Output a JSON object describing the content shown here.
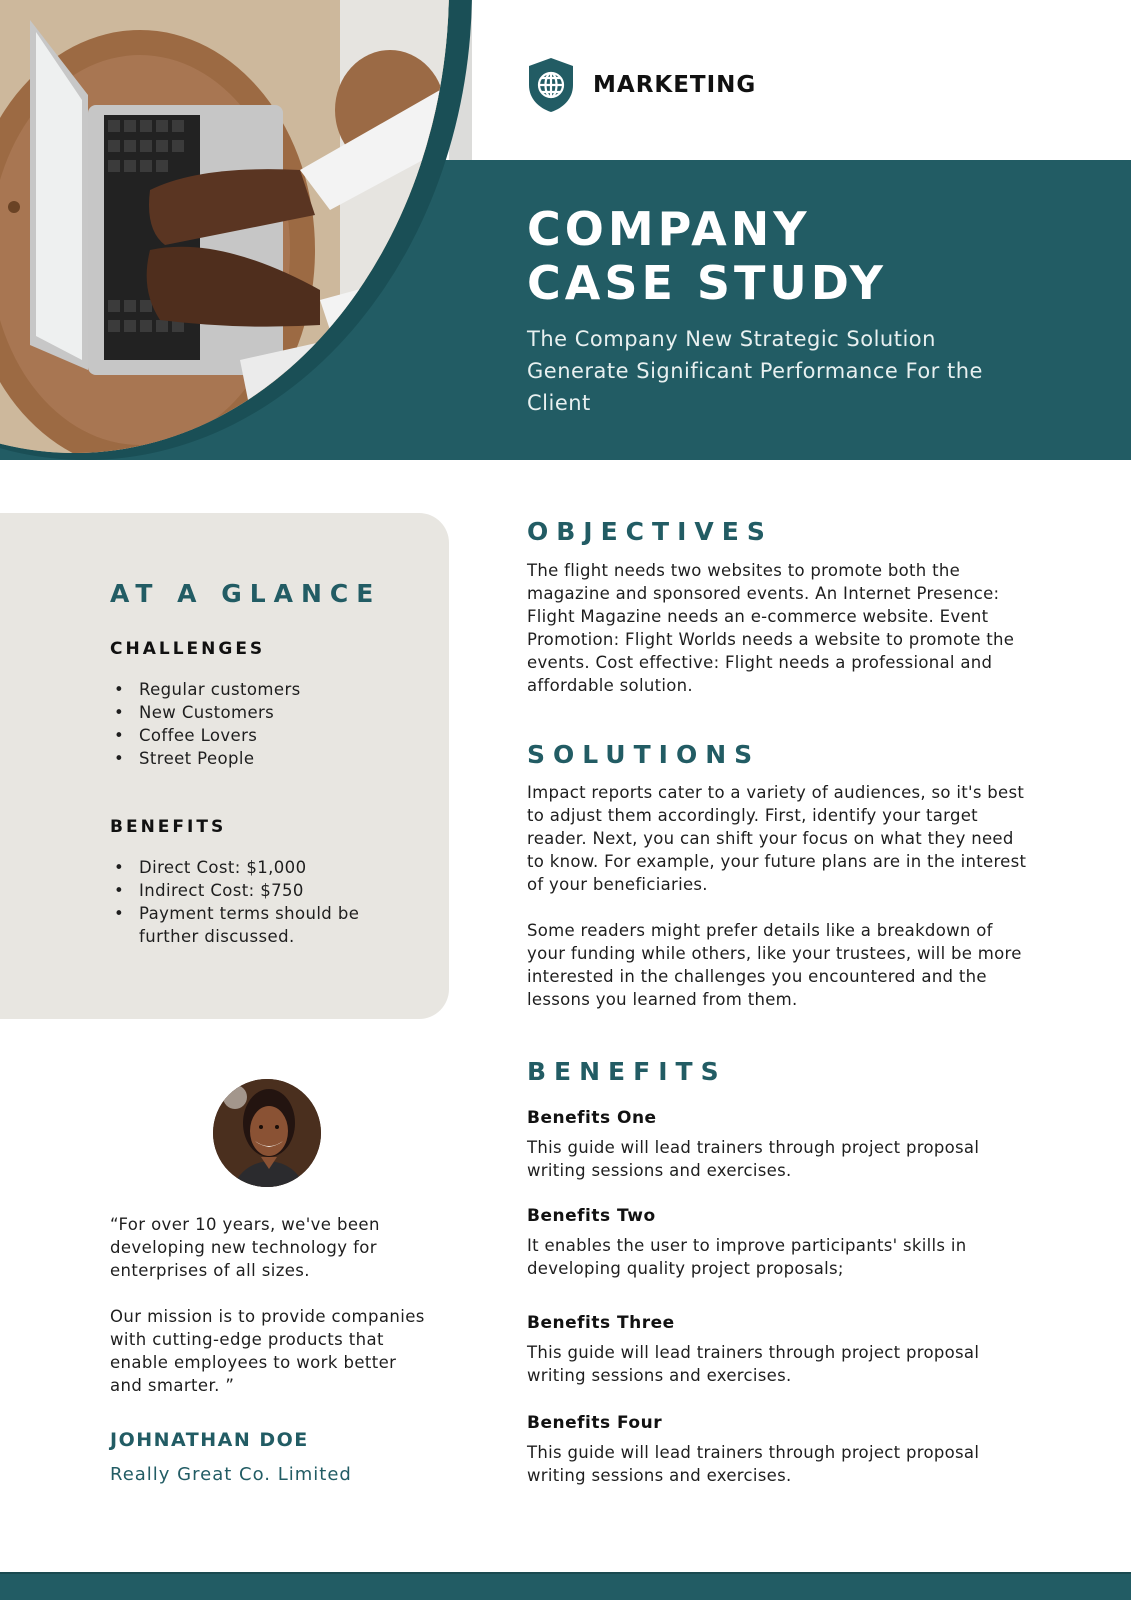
{
  "brand": {
    "icon": "shield-globe-icon",
    "label": "MARKETING"
  },
  "hero": {
    "title_line1": "COMPANY",
    "title_line2": "CASE STUDY",
    "subtitle": "The Company New Strategic Solution Generate Significant Performance For the Client",
    "photo": "hands-typing-on-laptop-photo"
  },
  "glance": {
    "title": "AT A GLANCE",
    "challenges": {
      "heading": "CHALLENGES",
      "items": [
        "Regular customers",
        "New Customers",
        "Coffee Lovers",
        "Street People"
      ]
    },
    "benefits": {
      "heading": "BENEFITS",
      "items": [
        "Direct Cost: $1,000",
        "Indirect Cost: $750",
        "Payment terms should be further discussed."
      ]
    }
  },
  "testimonial": {
    "avatar": "woman-portrait-photo",
    "quote_p1": "“For over 10 years, we've been developing new technology for enterprises of all sizes.",
    "quote_p2": "Our mission is to provide companies with cutting-edge products that enable employees to work better and smarter. ”",
    "author_name": "JOHNATHAN DOE",
    "author_company": "Really Great Co. Limited"
  },
  "objectives": {
    "title": "OBJECTIVES",
    "text": "The flight needs two websites to promote both the magazine and sponsored events. An Internet Presence: Flight Magazine needs an e-commerce website. Event Promotion: Flight Worlds needs a website to promote the events. Cost effective: Flight needs a professional and affordable solution."
  },
  "solutions": {
    "title": "SOLUTIONS",
    "p1": "Impact reports cater to a variety of audiences, so it's best to adjust them accordingly. First, identify your target reader. Next, you can shift your focus on what they need to know. For example, your future plans are in the interest of your beneficiaries.",
    "p2": "Some readers might prefer details like a breakdown of your funding while others, like your trustees, will be more interested in the challenges you encountered and the lessons you learned from them."
  },
  "benefits": {
    "title": "BENEFITS",
    "items": [
      {
        "heading": "Benefits One",
        "text": "This guide will lead trainers through project proposal writing sessions and exercises."
      },
      {
        "heading": "Benefits Two",
        "text": "It enables the user to improve participants' skills in developing quality project proposals;"
      },
      {
        "heading": "Benefits Three",
        "text": "This guide will lead trainers through project proposal writing sessions and exercises."
      },
      {
        "heading": "Benefits Four",
        "text": "This guide will lead trainers through project proposal writing sessions and exercises."
      }
    ]
  },
  "colors": {
    "accent_teal": "#225c64",
    "panel_beige": "#e8e6e1",
    "text_dark": "#1e1e1e"
  }
}
